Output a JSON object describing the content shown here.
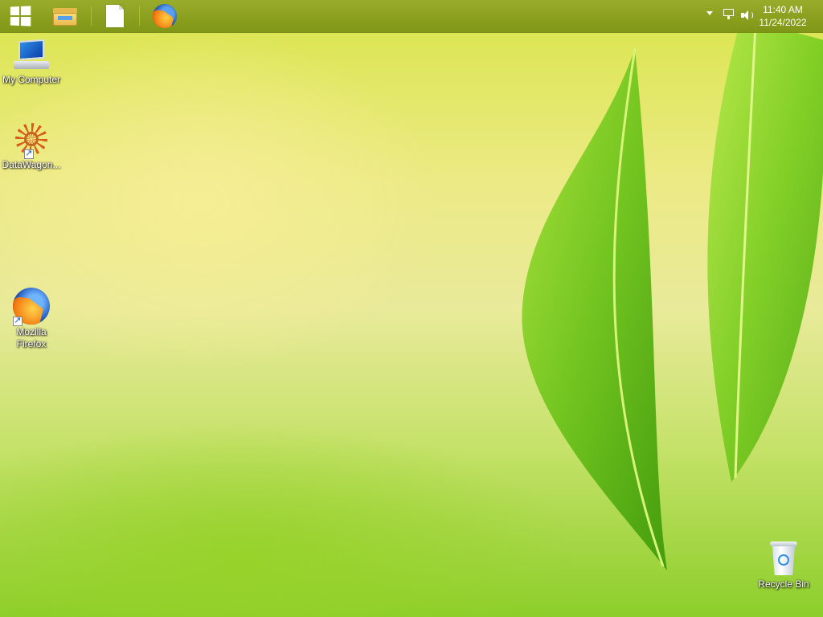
{
  "taskbar": {
    "pinned": [
      {
        "name": "file-explorer"
      },
      {
        "name": "blank-document"
      },
      {
        "name": "firefox"
      }
    ],
    "clock": {
      "time": "11:40 AM",
      "date": "11/24/2022"
    }
  },
  "desktop": {
    "icons": [
      {
        "label": "My Computer"
      },
      {
        "label": "DataWagon..."
      },
      {
        "label": "Mozilla Firefox"
      },
      {
        "label": "Recycle Bin"
      }
    ]
  }
}
